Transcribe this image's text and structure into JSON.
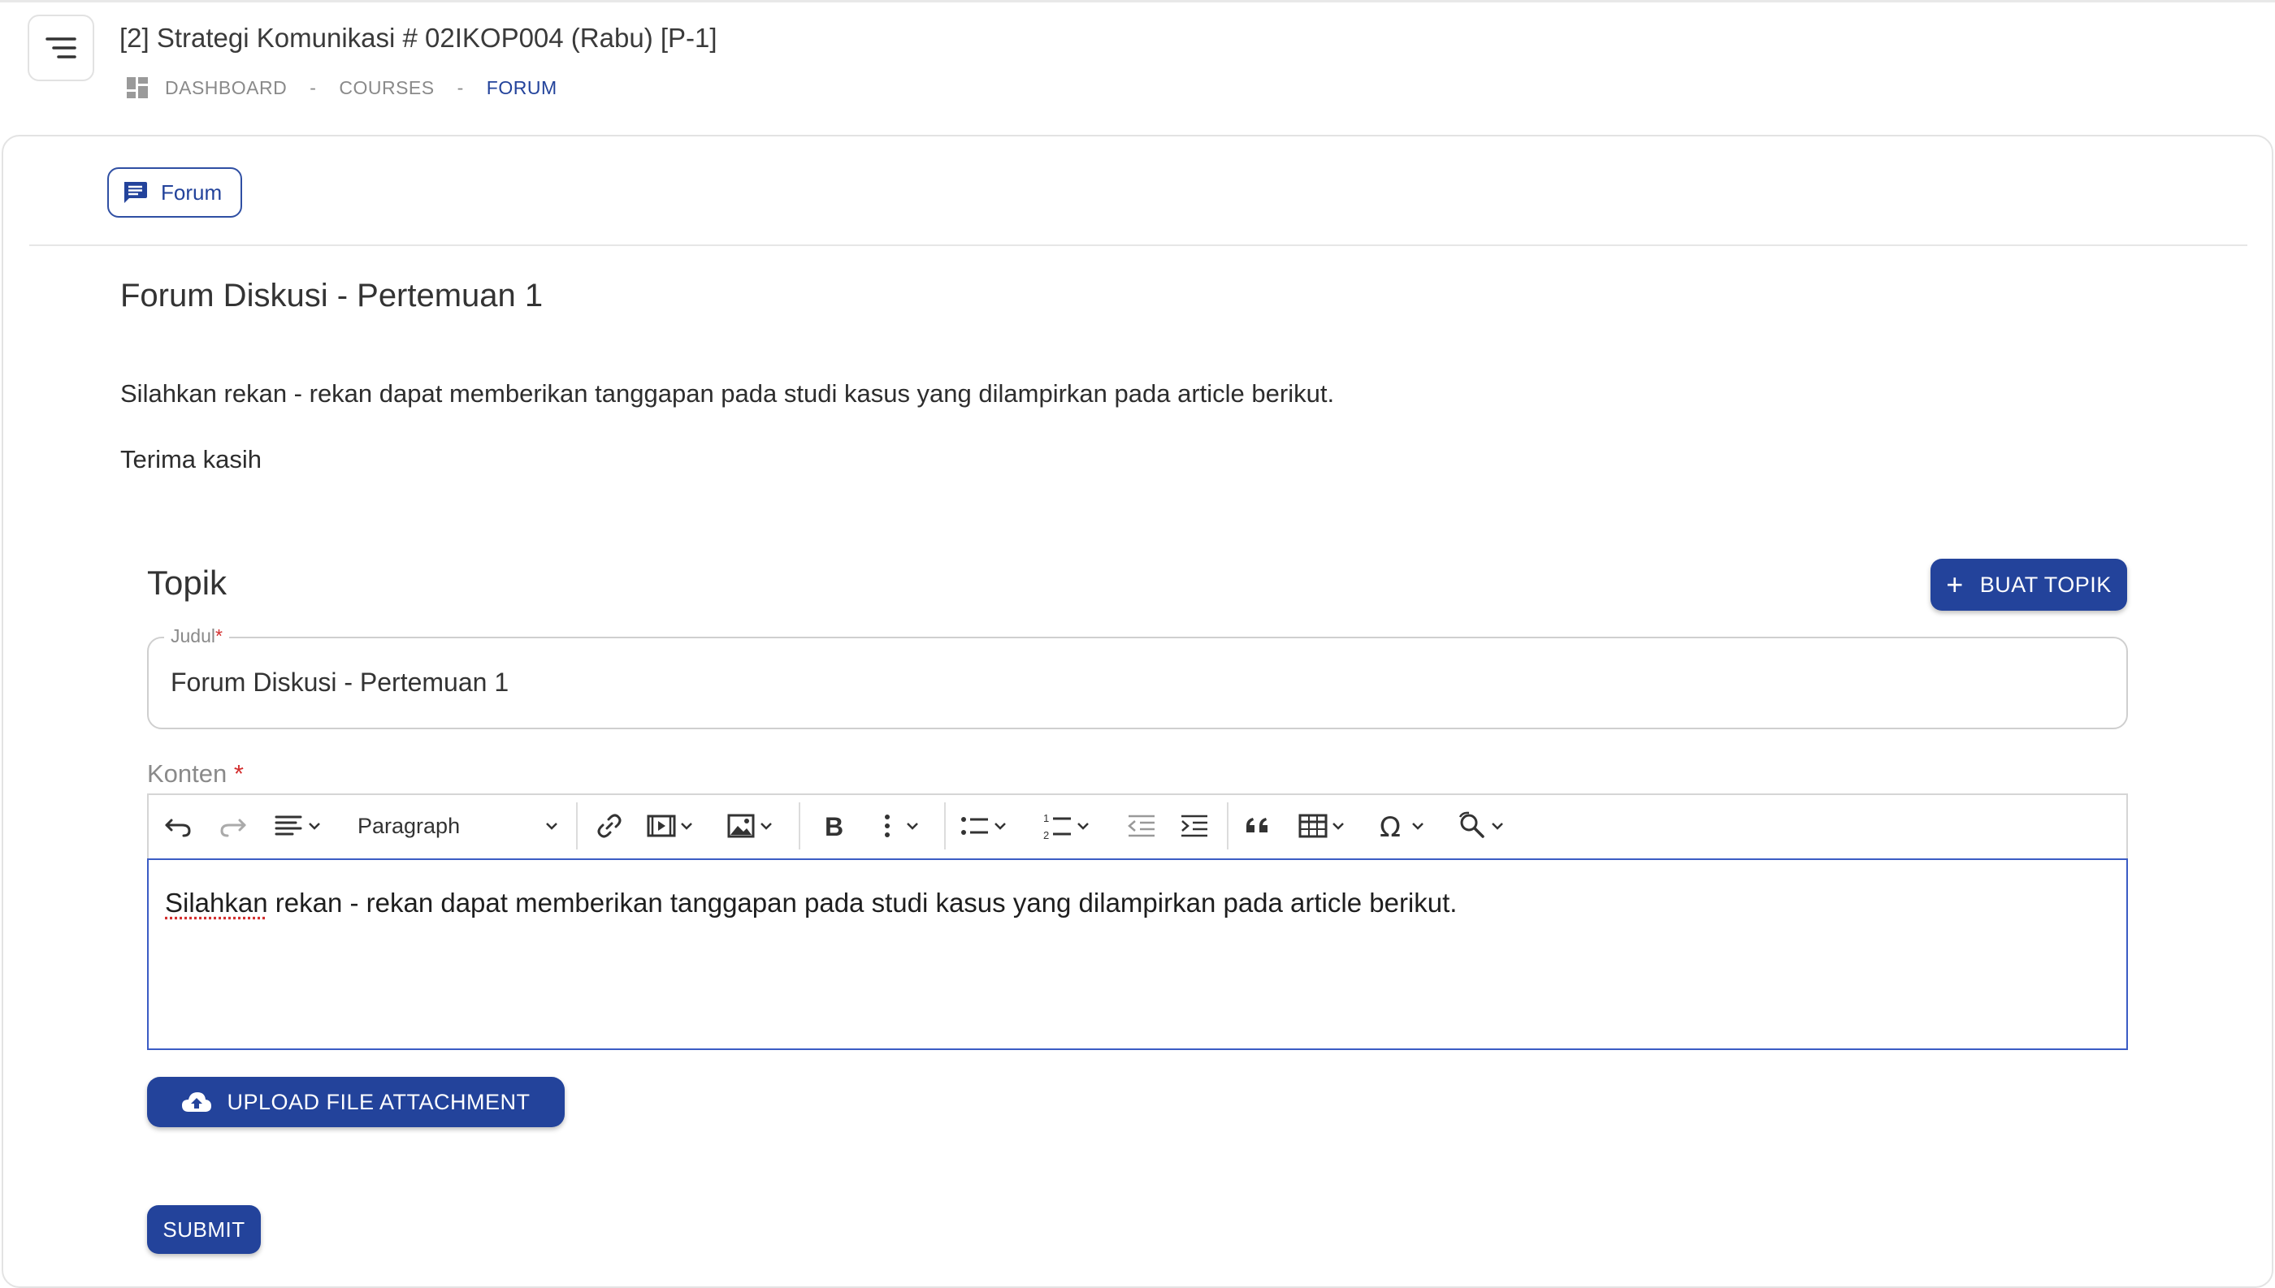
{
  "header": {
    "course_title": "[2] Strategi Komunikasi # 02IKOP004 (Rabu) [P-1]",
    "breadcrumb": [
      "DASHBOARD",
      "COURSES",
      "FORUM"
    ],
    "breadcrumb_separator": "-"
  },
  "tab": {
    "label": "Forum"
  },
  "forum": {
    "title": "Forum Diskusi - Pertemuan 1",
    "description": "Silahkan rekan - rekan dapat memberikan tanggapan pada studi kasus yang dilampirkan pada article berikut.",
    "closing": "Terima kasih"
  },
  "topik": {
    "heading": "Topik",
    "create_button": "BUAT TOPIK"
  },
  "form": {
    "judul_label": "Judul",
    "judul_value": "Forum Diskusi - Pertemuan 1",
    "konten_label": "Konten",
    "required_marker": "*",
    "paragraph_format": "Paragraph",
    "editor_content_first_word": "Silahkan",
    "editor_content_rest": " rekan - rekan dapat memberikan tanggapan pada studi kasus yang dilampirkan pada article berikut.",
    "upload_button": "UPLOAD FILE ATTACHMENT",
    "submit_button": "SUBMIT"
  },
  "toolbar_icons": [
    "undo-icon",
    "redo-icon",
    "align-icon",
    "link-icon",
    "media-icon",
    "image-icon",
    "bold-icon",
    "more-vertical-icon",
    "bulleted-list-icon",
    "numbered-list-icon",
    "outdent-icon",
    "indent-icon",
    "blockquote-icon",
    "table-icon",
    "special-characters-icon",
    "find-replace-icon"
  ],
  "colors": {
    "primary": "#23439b",
    "required": "#d32f2f",
    "editor_focus_border": "#3b5cc4"
  }
}
